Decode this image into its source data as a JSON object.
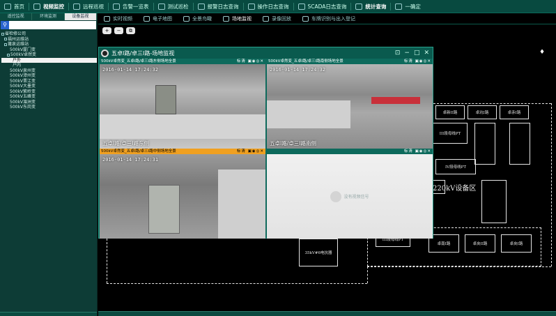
{
  "nav": {
    "items": [
      {
        "icon": "home-icon",
        "label": "首页"
      },
      {
        "icon": "video-icon",
        "label": "视频监控",
        "active": true
      },
      {
        "icon": "remote-icon",
        "label": "远程巡视"
      },
      {
        "icon": "alarm-icon",
        "label": "告警一览表"
      },
      {
        "icon": "test-icon",
        "label": "测试巡检"
      },
      {
        "icon": "log-icon",
        "label": "报警日志查询"
      },
      {
        "icon": "oplog-icon",
        "label": "操作日志查询"
      },
      {
        "icon": "scada-icon",
        "label": "SCADA日志查询"
      },
      {
        "icon": "stats-icon",
        "label": "统计查询"
      },
      {
        "icon": "more-icon",
        "label": "一确定"
      }
    ]
  },
  "left": {
    "tabs": [
      "遥控监视",
      "环境监测",
      "设备监视"
    ],
    "active_tab": 2,
    "search": {
      "placeholder": "",
      "value": ""
    },
    "tree": [
      {
        "label": "省检修公司",
        "level": 0,
        "exp": true
      },
      {
        "label": "福州运维站",
        "level": 1,
        "exp": true
      },
      {
        "label": "莆泉运维站",
        "level": 1,
        "exp": true
      },
      {
        "label": "500kV厦门变",
        "level": 2
      },
      {
        "label": "500kV卓然变",
        "level": 2,
        "exp": true
      },
      {
        "label": "户外",
        "level": 3,
        "selected": true
      },
      {
        "label": "户内",
        "level": 3
      },
      {
        "label": "500kV泉州变",
        "level": 2
      },
      {
        "label": "500kV漳州变",
        "level": 2
      },
      {
        "label": "500kV晋江变",
        "level": 2
      },
      {
        "label": "500kV大墨变",
        "level": 2
      },
      {
        "label": "500kV紫岭变",
        "level": 2
      },
      {
        "label": "500kV五峰变",
        "level": 2
      },
      {
        "label": "500kV湄洲变",
        "level": 2
      },
      {
        "label": "500kV东岗变",
        "level": 2
      }
    ]
  },
  "subtabs": [
    {
      "icon": "realtime-icon",
      "label": "实时视频"
    },
    {
      "icon": "map-icon",
      "label": "电子地图"
    },
    {
      "icon": "eye-icon",
      "label": "全景鸟瞰"
    },
    {
      "icon": "site-icon",
      "label": "场地监视",
      "active": true
    },
    {
      "icon": "playback-icon",
      "label": "录像回放"
    },
    {
      "icon": "car-icon",
      "label": "车牌识别与出入登记"
    }
  ],
  "popup": {
    "title": "五卓I路/卓三I路-场地监视",
    "cams": [
      {
        "head": "500kV卓然变_五卓I路/卓三I路东侧场地全景",
        "ts": "2016-01-14 17:24:32",
        "caption": "五卓I路/卓三I路东侧",
        "orange": false
      },
      {
        "head": "500kV卓然变_五卓I路/卓三I路南侧场地全景",
        "ts": "2016-01-14 17:24:32",
        "caption": "五卓I路/卓三I路南侧",
        "orange": false
      },
      {
        "head": "500kV卓然变_五卓I路/卓三I路中侧场地全景",
        "ts": "2016-01-14 17:24:31",
        "caption": "",
        "orange": true
      },
      {
        "head": "",
        "ts": "",
        "caption": "",
        "nosignal": "没有视频信号",
        "orange": false
      }
    ],
    "head_status": "标清"
  },
  "map": {
    "area_label": "220kV设备区",
    "boxes": [
      "卓新II路",
      "卓坑I路",
      "卓赤I路",
      "III段母线PT",
      "IV段母线PT",
      "III段母线PT",
      "卓南I路",
      "卓央II路",
      "卓央I路",
      "35kV#6电抗器"
    ]
  }
}
